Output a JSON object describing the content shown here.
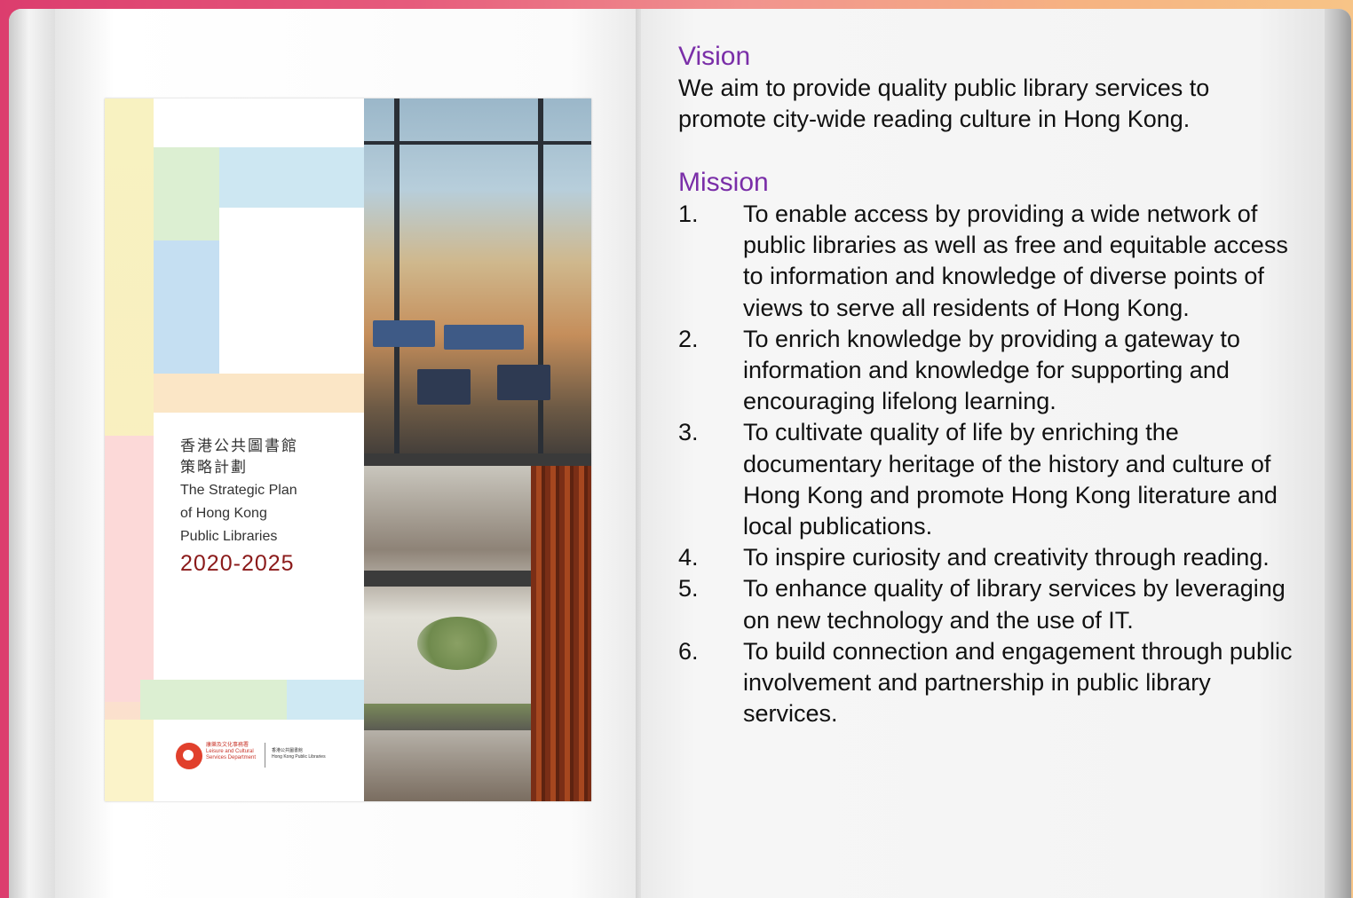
{
  "cover": {
    "title_zh_line1": "香港公共圖書館",
    "title_zh_line2": "策略計劃",
    "title_en_line1": "The Strategic Plan",
    "title_en_line2": "of Hong Kong",
    "title_en_line3": "Public Libraries",
    "years": "2020-2025",
    "logo1_zh": "康樂及文化事務署",
    "logo1_en": "Leisure and Cultural Services Department",
    "logo2_zh": "香港公共圖書館",
    "logo2_en": "Hong Kong Public Libraries"
  },
  "vision": {
    "heading": "Vision",
    "text_line1": "We aim to provide quality public library services to",
    "text_line2": "promote city-wide reading culture in Hong Kong."
  },
  "mission": {
    "heading": "Mission",
    "items": [
      {
        "num": "1.",
        "text": "To enable access by providing a wide network of public libraries as well as free and equitable access to information and knowledge of diverse points of views to serve all residents of Hong Kong."
      },
      {
        "num": "2.",
        "text": "To enrich knowledge by providing a gateway to information and knowledge for supporting and encouraging lifelong learning."
      },
      {
        "num": "3.",
        "text": "To cultivate quality of life by enriching the documentary heritage of the history and culture of Hong Kong and promote Hong Kong literature and local publications."
      },
      {
        "num": "4.",
        "text": "To inspire curiosity and creativity through reading."
      },
      {
        "num": "5.",
        "text": "To enhance quality of library services by leveraging on new technology and the use of IT."
      },
      {
        "num": "6.",
        "text": "To build connection and engagement through public involvement and partnership in public library services."
      }
    ]
  }
}
